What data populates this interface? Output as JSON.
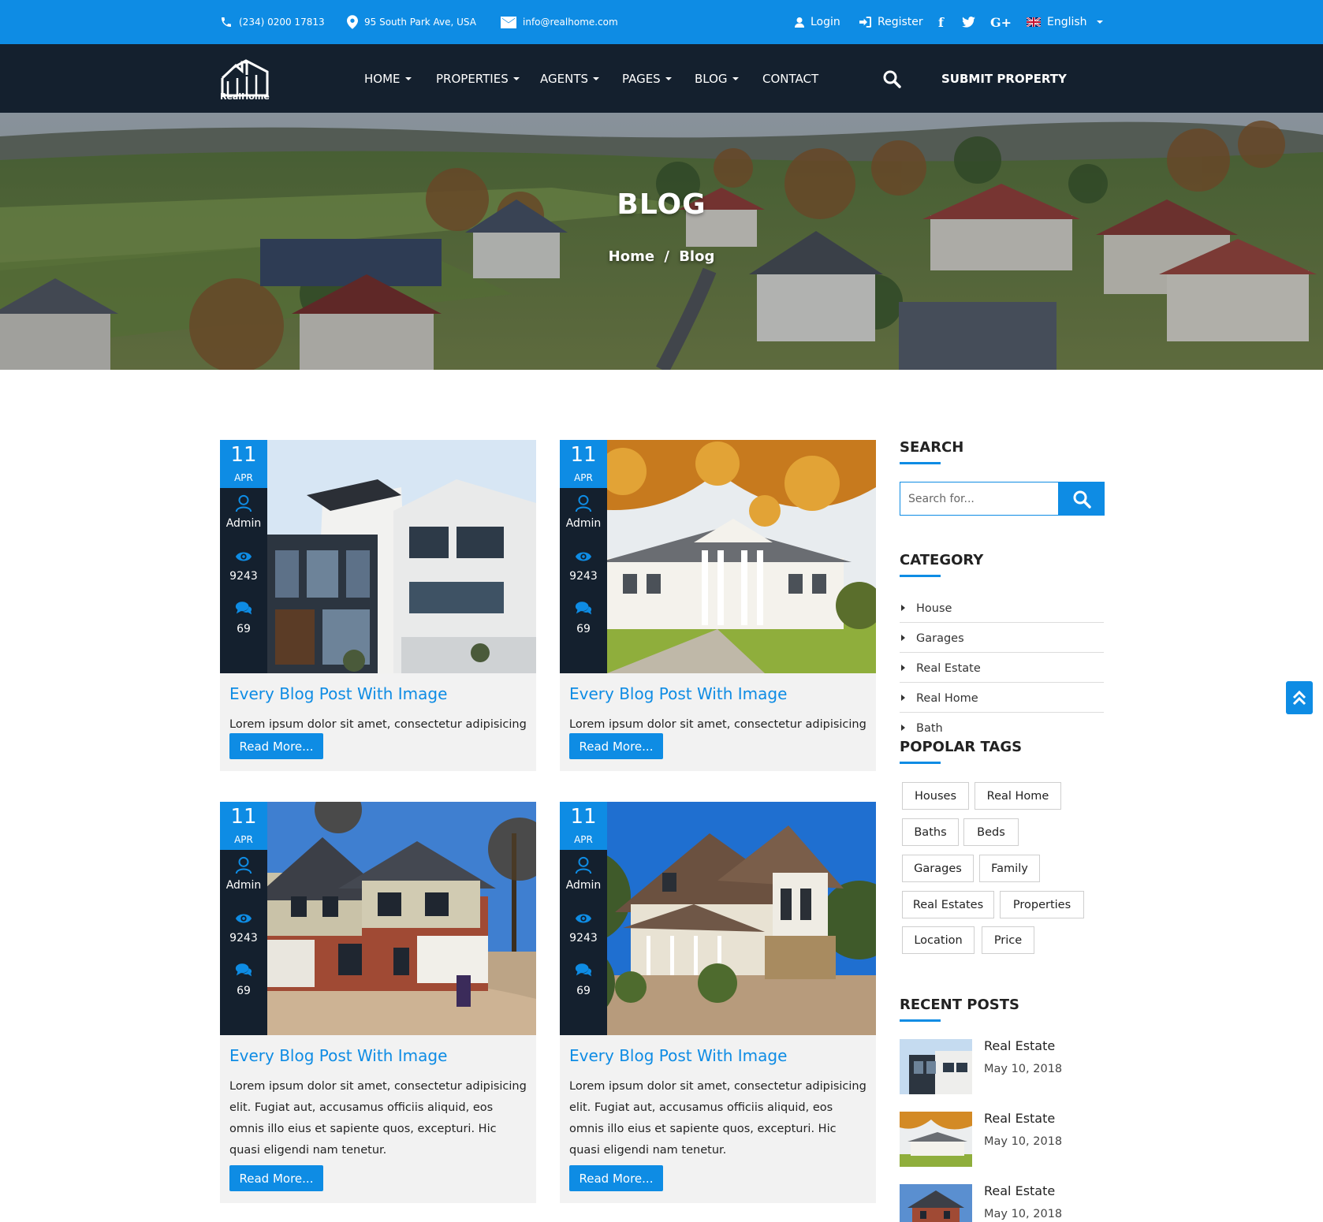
{
  "topbar": {
    "phone": "(234) 0200 17813",
    "address": "95 South Park Ave, USA",
    "email": "info@realhome.com",
    "login": "Login",
    "register": "Register",
    "social": [
      "f",
      "t",
      "G+"
    ],
    "language": "English"
  },
  "nav": {
    "logo_text": "RealHome",
    "links": [
      "HOME",
      "PROPERTIES",
      "AGENTS",
      "PAGES",
      "BLOG",
      "CONTACT"
    ],
    "submit": "SUBMIT PROPERTY"
  },
  "hero": {
    "title": "BLOG",
    "crumb_home": "Home",
    "crumb_sep": "/",
    "crumb_current": "Blog"
  },
  "posts": [
    {
      "day": "11",
      "month": "APR",
      "author": "Admin",
      "views": "9243",
      "comments": "69",
      "title": "Every Blog Post With Image",
      "excerpt": "Lorem ipsum dolor sit amet, consectetur adipisicing",
      "button": "Read More..."
    },
    {
      "day": "11",
      "month": "APR",
      "author": "Admin",
      "views": "9243",
      "comments": "69",
      "title": "Every Blog Post With Image",
      "excerpt": "Lorem ipsum dolor sit amet, consectetur adipisicing",
      "button": "Read More..."
    },
    {
      "day": "11",
      "month": "APR",
      "author": "Admin",
      "views": "9243",
      "comments": "69",
      "title": "Every Blog Post With Image",
      "excerpt": "Lorem ipsum dolor sit amet, consectetur adipisicing elit. Fugiat aut, accusamus officiis aliquid, eos omnis illo eius et sapiente quos, excepturi. Hic quasi eligendi nam tenetur.",
      "button": "Read More..."
    },
    {
      "day": "11",
      "month": "APR",
      "author": "Admin",
      "views": "9243",
      "comments": "69",
      "title": "Every Blog Post With Image",
      "excerpt": "Lorem ipsum dolor sit amet, consectetur adipisicing elit. Fugiat aut, accusamus officiis aliquid, eos omnis illo eius et sapiente quos, excepturi. Hic quasi eligendi nam tenetur.",
      "button": "Read More..."
    }
  ],
  "sidebar": {
    "search_heading": "SEARCH",
    "search_placeholder": "Search for...",
    "category_heading": "CATEGORY",
    "categories": [
      "House",
      "Garages",
      "Real Estate",
      "Real Home",
      "Bath"
    ],
    "tags_heading": "POPOLAR TAGS",
    "tags": [
      "Houses",
      "Real Home",
      "Baths",
      "Beds",
      "Garages",
      "Family",
      "Real Estates",
      "Properties",
      "Location",
      "Price"
    ],
    "recent_heading": "RECENT POSTS",
    "recent": [
      {
        "title": "Real Estate",
        "date": "May 10, 2018"
      },
      {
        "title": "Real Estate",
        "date": "May 10, 2018"
      },
      {
        "title": "Real Estate",
        "date": "May 10, 2018"
      }
    ]
  },
  "colors": {
    "accent": "#0e8ce4",
    "dark": "#14202e",
    "card_bg": "#f2f2f2"
  }
}
